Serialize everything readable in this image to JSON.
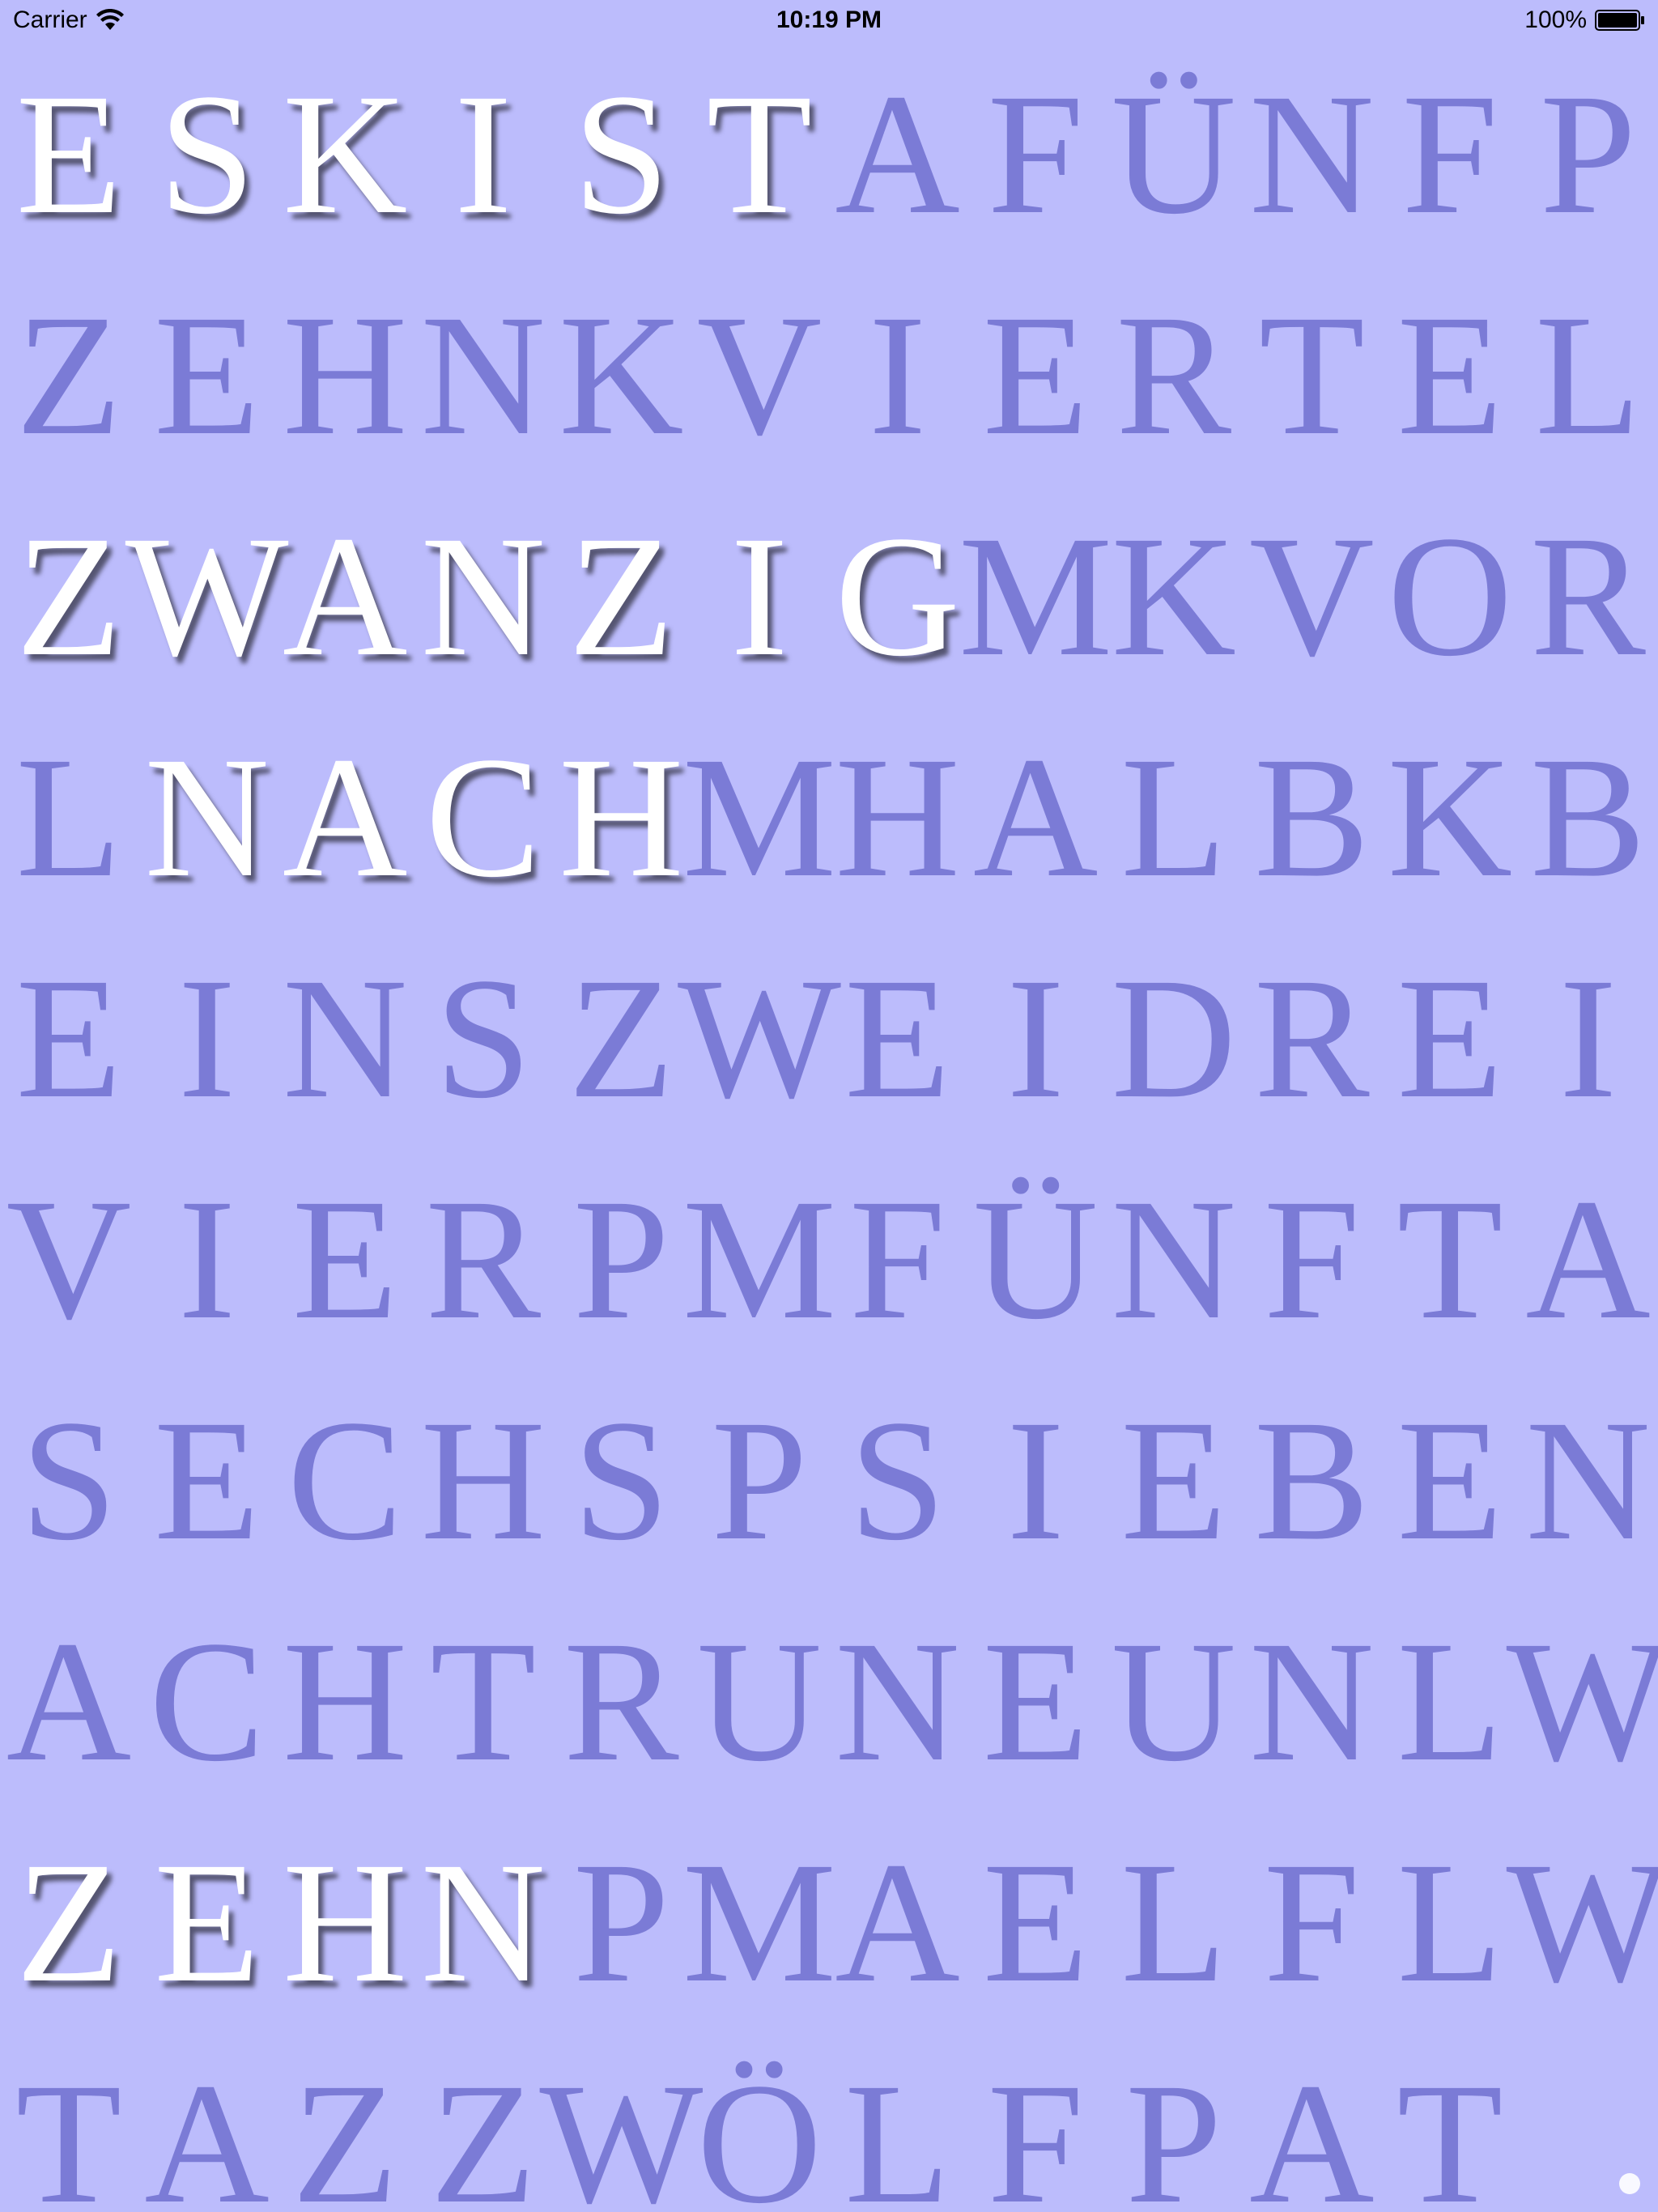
{
  "status_bar": {
    "carrier": "Carrier",
    "time": "10:19 PM",
    "battery": "100%",
    "wifi_icon": "wifi-icon",
    "battery_icon": "battery-icon"
  },
  "colors": {
    "background": "#bcbcfc",
    "inactive_letter": "#7b7bd6",
    "active_letter": "#ffffff"
  },
  "word_clock": {
    "rows": [
      {
        "letters": [
          "E",
          "S",
          "K",
          "I",
          "S",
          "T",
          "A",
          "F",
          "Ü",
          "N",
          "F",
          "P"
        ],
        "lit": [
          1,
          1,
          1,
          1,
          1,
          1,
          0,
          0,
          0,
          0,
          0,
          0
        ]
      },
      {
        "letters": [
          "Z",
          "E",
          "H",
          "N",
          "K",
          "V",
          "I",
          "E",
          "R",
          "T",
          "E",
          "L"
        ],
        "lit": [
          0,
          0,
          0,
          0,
          0,
          0,
          0,
          0,
          0,
          0,
          0,
          0
        ]
      },
      {
        "letters": [
          "Z",
          "W",
          "A",
          "N",
          "Z",
          "I",
          "G",
          "M",
          "K",
          "V",
          "O",
          "R"
        ],
        "lit": [
          1,
          1,
          1,
          1,
          1,
          1,
          1,
          0,
          0,
          0,
          0,
          0
        ]
      },
      {
        "letters": [
          "L",
          "N",
          "A",
          "C",
          "H",
          "M",
          "H",
          "A",
          "L",
          "B",
          "K",
          "B"
        ],
        "lit": [
          0,
          1,
          1,
          1,
          1,
          0,
          0,
          0,
          0,
          0,
          0,
          0
        ]
      },
      {
        "letters": [
          "E",
          "I",
          "N",
          "S",
          "Z",
          "W",
          "E",
          "I",
          "D",
          "R",
          "E",
          "I"
        ],
        "lit": [
          0,
          0,
          0,
          0,
          0,
          0,
          0,
          0,
          0,
          0,
          0,
          0
        ]
      },
      {
        "letters": [
          "V",
          "I",
          "E",
          "R",
          "P",
          "M",
          "F",
          "Ü",
          "N",
          "F",
          "T",
          "A"
        ],
        "lit": [
          0,
          0,
          0,
          0,
          0,
          0,
          0,
          0,
          0,
          0,
          0,
          0
        ]
      },
      {
        "letters": [
          "S",
          "E",
          "C",
          "H",
          "S",
          "P",
          "S",
          "I",
          "E",
          "B",
          "E",
          "N"
        ],
        "lit": [
          0,
          0,
          0,
          0,
          0,
          0,
          0,
          0,
          0,
          0,
          0,
          0
        ]
      },
      {
        "letters": [
          "A",
          "C",
          "H",
          "T",
          "R",
          "U",
          "N",
          "E",
          "U",
          "N",
          "L",
          "W"
        ],
        "lit": [
          0,
          0,
          0,
          0,
          0,
          0,
          0,
          0,
          0,
          0,
          0,
          0
        ]
      },
      {
        "letters": [
          "Z",
          "E",
          "H",
          "N",
          "P",
          "M",
          "A",
          "E",
          "L",
          "F",
          "L",
          "W"
        ],
        "lit": [
          1,
          1,
          1,
          1,
          0,
          0,
          0,
          0,
          0,
          0,
          0,
          0
        ]
      },
      {
        "letters": [
          "T",
          "A",
          "Z",
          "Z",
          "W",
          "Ö",
          "L",
          "F",
          "P",
          "A",
          "T",
          ""
        ],
        "lit": [
          0,
          0,
          0,
          0,
          0,
          0,
          0,
          0,
          0,
          0,
          0,
          0
        ]
      }
    ]
  }
}
